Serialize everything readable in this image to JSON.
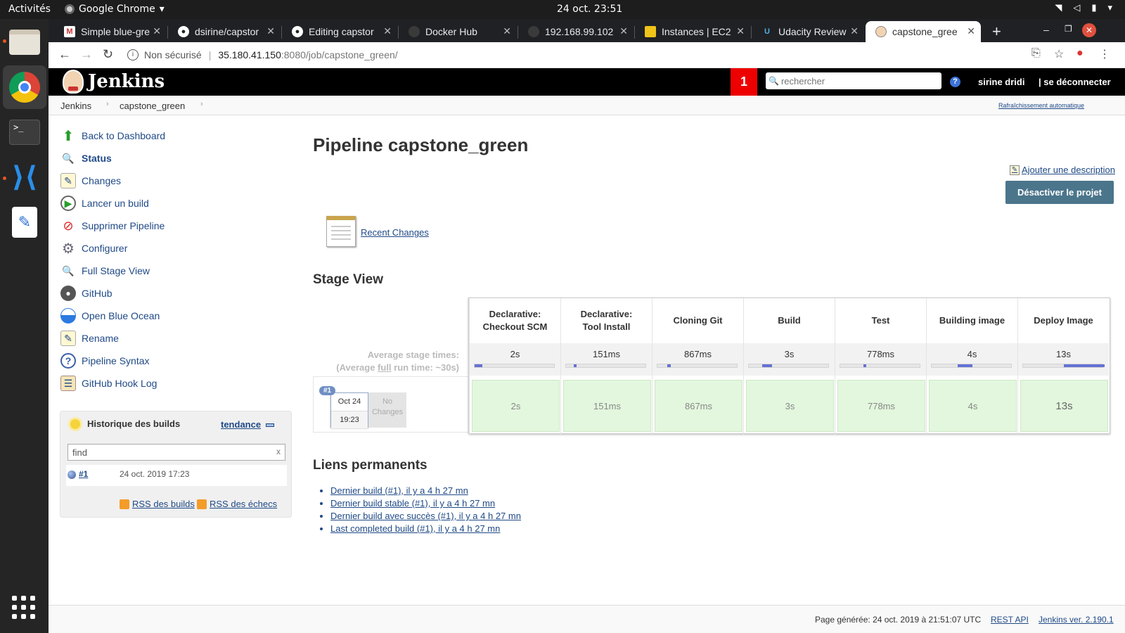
{
  "os": {
    "activities": "Activités",
    "app_name": "Google Chrome",
    "clock": "24 oct.  23:51"
  },
  "tabs": [
    {
      "label": "Simple blue-gre",
      "favicon": "gmail-icon"
    },
    {
      "label": "dsirine/capstor",
      "favicon": "github-icon"
    },
    {
      "label": "Editing capstor",
      "favicon": "github-icon"
    },
    {
      "label": "Docker Hub",
      "favicon": "docker-icon"
    },
    {
      "label": "192.168.99.102",
      "favicon": "globe-icon"
    },
    {
      "label": "Instances | EC2",
      "favicon": "aws-icon"
    },
    {
      "label": "Udacity Review",
      "favicon": "udacity-icon"
    },
    {
      "label": "capstone_gree",
      "favicon": "jenkins-icon",
      "active": true
    }
  ],
  "address": {
    "security": "Non sécurisé",
    "host": "35.180.41.150",
    "path": ":8080/job/capstone_green/"
  },
  "jenkins": {
    "title": "Jenkins",
    "notification_count": "1",
    "search_placeholder": "rechercher",
    "user": "sirine dridi",
    "logout": "| se déconnecter",
    "accent": "#e00000"
  },
  "breadcrumb": {
    "root": "Jenkins",
    "job": "capstone_green",
    "autorefresh": "Rafraîchissement automatique"
  },
  "sidebar": {
    "items": [
      {
        "label": "Back to Dashboard",
        "icon": "up-arrow-icon"
      },
      {
        "label": "Status",
        "icon": "magnifier-icon"
      },
      {
        "label": "Changes",
        "icon": "notepad-icon"
      },
      {
        "label": "Lancer un build",
        "icon": "clock-play-icon"
      },
      {
        "label": "Supprimer Pipeline",
        "icon": "no-entry-icon"
      },
      {
        "label": "Configurer",
        "icon": "gear-icon"
      },
      {
        "label": "Full Stage View",
        "icon": "magnifier-icon"
      },
      {
        "label": "GitHub",
        "icon": "github-icon"
      },
      {
        "label": "Open Blue Ocean",
        "icon": "blue-ocean-icon"
      },
      {
        "label": "Rename",
        "icon": "notepad-icon"
      },
      {
        "label": "Pipeline Syntax",
        "icon": "help-icon"
      },
      {
        "label": "GitHub Hook Log",
        "icon": "clipboard-icon"
      }
    ]
  },
  "history": {
    "title": "Historique des builds",
    "trend": "tendance",
    "find_placeholder": "find",
    "clear": "x",
    "build_number": "#1",
    "build_date": "24 oct. 2019 17:23",
    "rss_all": "RSS des builds",
    "rss_failed": "RSS des échecs"
  },
  "main": {
    "title": "Pipeline capstone_green",
    "add_description": "Ajouter une description",
    "disable_button": "Désactiver le projet",
    "recent_changes": "Recent Changes",
    "stage_view_title": "Stage View",
    "avg_stage_label": "Average stage times:",
    "avg_full_prefix": "(Average ",
    "avg_full_word": "full",
    "avg_full_suffix": " run time: ~30s)",
    "run": {
      "badge": "#1",
      "date": "Oct 24",
      "time": "19:23",
      "no_changes_1": "No",
      "no_changes_2": "Changes"
    },
    "stages": [
      {
        "name1": "Declarative:",
        "name2": "Checkout SCM",
        "avg": "2s",
        "run": "2s",
        "avg_fraction": 0.1
      },
      {
        "name1": "Declarative:",
        "name2": "Tool Install",
        "avg": "151ms",
        "run": "151ms",
        "avg_fraction": 0.02
      },
      {
        "name1": "Cloning Git",
        "name2": "",
        "avg": "867ms",
        "run": "867ms",
        "avg_fraction": 0.05
      },
      {
        "name1": "Build",
        "name2": "",
        "avg": "3s",
        "run": "3s",
        "avg_fraction": 0.12
      },
      {
        "name1": "Test",
        "name2": "",
        "avg": "778ms",
        "run": "778ms",
        "avg_fraction": 0.04
      },
      {
        "name1": "Building image",
        "name2": "",
        "avg": "4s",
        "run": "4s",
        "avg_fraction": 0.18
      },
      {
        "name1": "Deploy Image",
        "name2": "",
        "avg": "13s",
        "run": "13s",
        "avg_fraction": 0.52
      }
    ],
    "permalinks_title": "Liens permanents",
    "permalinks": [
      "Dernier build (#1), il y a 4 h 27 mn",
      "Dernier build stable (#1), il y a 4 h 27 mn",
      "Dernier build avec succès (#1), il y a 4 h 27 mn",
      "Last completed build (#1), il y a 4 h 27 mn"
    ]
  },
  "footer": {
    "generated": "Page générée: 24 oct. 2019 à 21:51:07 UTC",
    "rest_api": "REST API",
    "version": "Jenkins ver. 2.190.1"
  }
}
